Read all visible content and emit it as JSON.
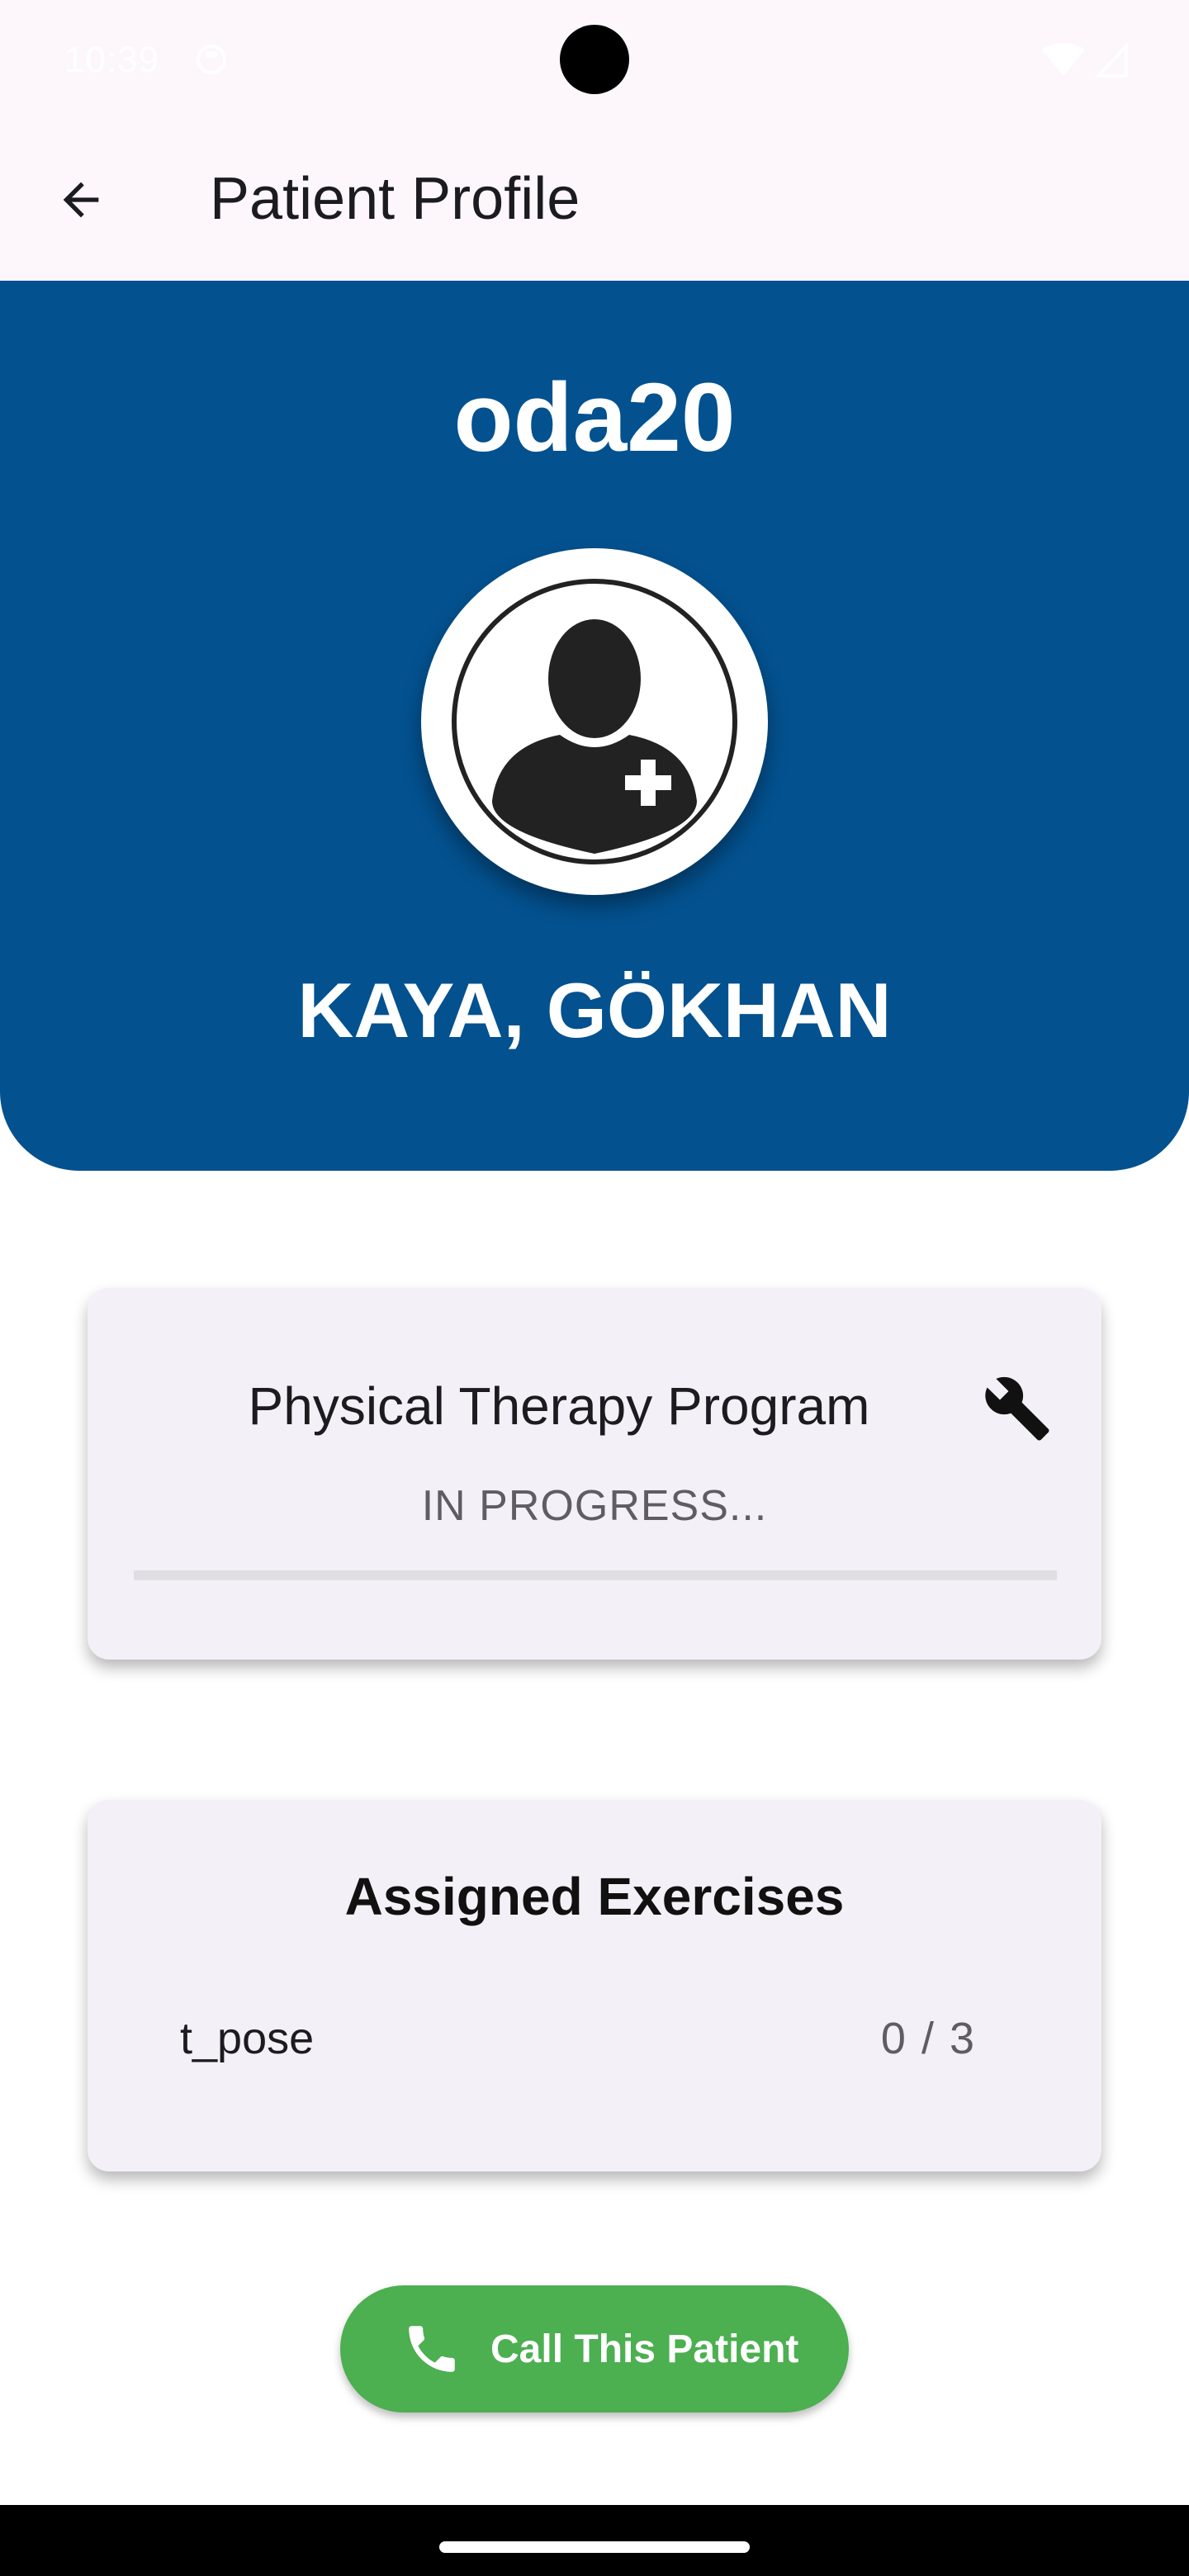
{
  "status_bar": {
    "time": "10:39"
  },
  "app_bar": {
    "title": "Patient Profile"
  },
  "header": {
    "room": "oda20",
    "patient_name": "KAYA, GÖKHAN"
  },
  "program_card": {
    "title": "Physical Therapy Program",
    "status": "IN PROGRESS...",
    "progress_fraction": 0
  },
  "exercises_card": {
    "title": "Assigned Exercises",
    "items": [
      {
        "name": "t_pose",
        "count": "0 / 3"
      }
    ]
  },
  "call_button": {
    "label": "Call This Patient"
  },
  "colors": {
    "header": "#03518f",
    "call": "#4caf50",
    "card": "#f4f0f7",
    "app_bar": "#fdf7fc"
  },
  "icons": [
    "back-arrow-icon",
    "patient-avatar-icon",
    "wrench-icon",
    "phone-icon"
  ]
}
